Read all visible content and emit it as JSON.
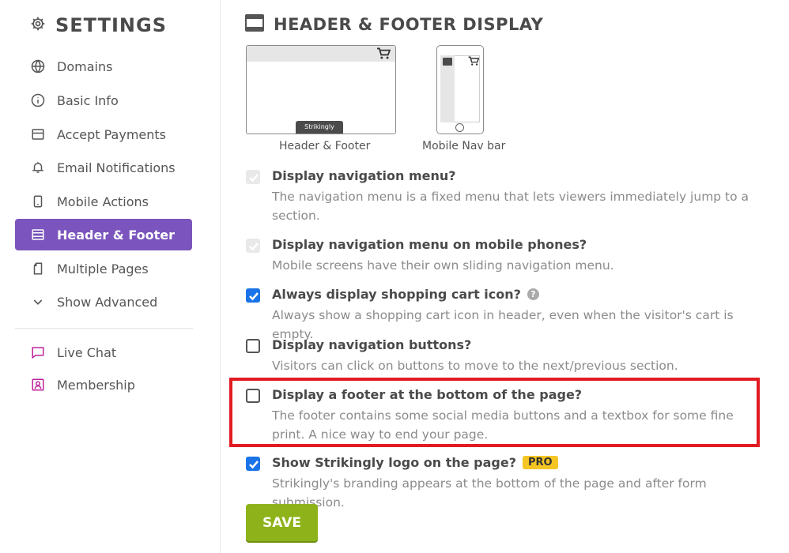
{
  "sidebar": {
    "title": "SETTINGS",
    "items": [
      {
        "label": "Domains",
        "icon": "globe-icon"
      },
      {
        "label": "Basic Info",
        "icon": "info-icon"
      },
      {
        "label": "Accept Payments",
        "icon": "credit-card-icon"
      },
      {
        "label": "Email Notifications",
        "icon": "bell-icon"
      },
      {
        "label": "Mobile Actions",
        "icon": "mobile-icon"
      },
      {
        "label": "Header & Footer",
        "icon": "header-footer-icon",
        "active": true
      },
      {
        "label": "Multiple Pages",
        "icon": "pages-icon"
      },
      {
        "label": "Show Advanced",
        "icon": "chevron-down-icon"
      }
    ],
    "extra_items": [
      {
        "label": "Live Chat",
        "icon": "chat-icon"
      },
      {
        "label": "Membership",
        "icon": "membership-icon"
      }
    ]
  },
  "main": {
    "title": "HEADER & FOOTER DISPLAY",
    "previews": [
      {
        "caption": "Header & Footer",
        "badge": "Strikingly"
      },
      {
        "caption": "Mobile Nav bar"
      }
    ],
    "options": [
      {
        "title": "Display navigation menu?",
        "desc": "The navigation menu is a fixed menu that lets viewers immediately jump to a section.",
        "state": "disabled-checked"
      },
      {
        "title": "Display navigation menu on mobile phones?",
        "desc": "Mobile screens have their own sliding navigation menu.",
        "state": "disabled-checked"
      },
      {
        "title": "Always display shopping cart icon?",
        "desc": "Always show a shopping cart icon in header, even when the visitor's cart is empty.",
        "state": "checked",
        "help": "?"
      },
      {
        "title": "Display navigation buttons?",
        "desc": "Visitors can click on buttons to move to the next/previous section.",
        "state": "unchecked"
      },
      {
        "title": "Display a footer at the bottom of the page?",
        "desc": "The footer contains some social media buttons and a textbox for some fine print. A nice way to end your page.",
        "state": "unchecked"
      },
      {
        "title": "Show Strikingly logo on the page?",
        "desc": "Strikingly's branding appears at the bottom of the page and after form submission.",
        "state": "checked",
        "badge": "PRO"
      }
    ],
    "save_label": "SAVE"
  },
  "colors": {
    "accent": "#7b55bd",
    "checkbox": "#1a73e8",
    "save": "#8eb31a",
    "highlight": "#e11b22",
    "pro": "#f5c623"
  }
}
